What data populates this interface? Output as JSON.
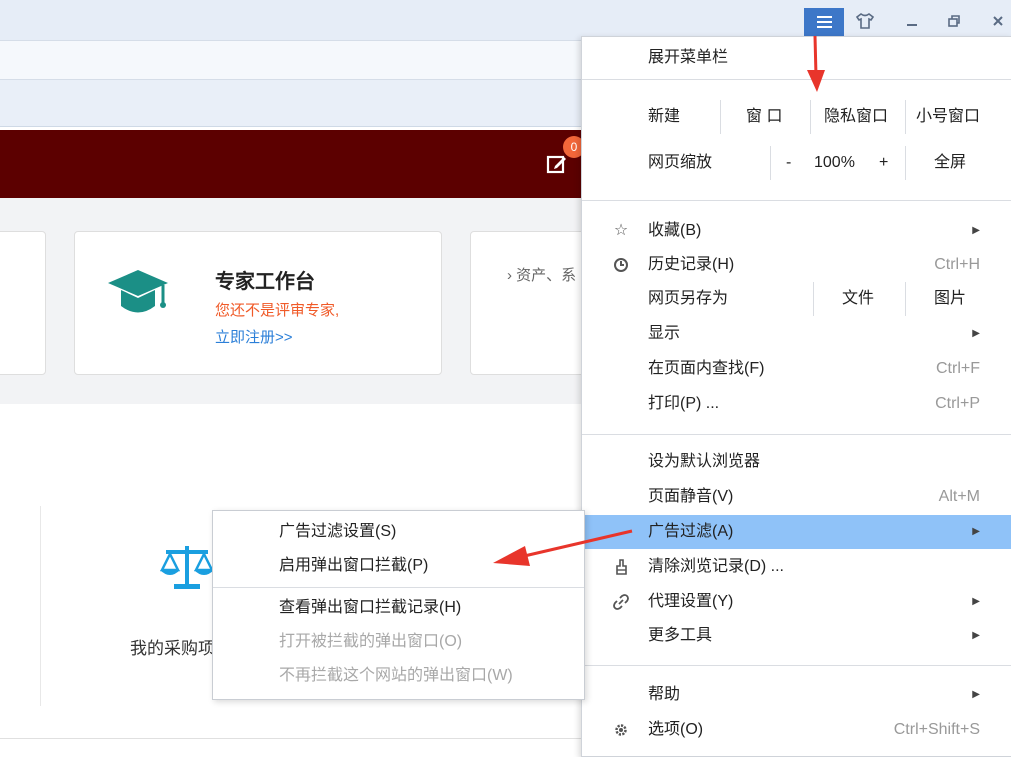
{
  "banner": {
    "badge_count": "0"
  },
  "card_expert": {
    "title": "专家工作台",
    "warn": "您还不是评审专家,",
    "link": "立即注册>>"
  },
  "card_assets": {
    "text": "› 资产、系"
  },
  "purchase": {
    "label": "我的采购项"
  },
  "main_menu": {
    "expand_menubar": "展开菜单栏",
    "new": {
      "label": "新建",
      "window": "窗 口",
      "private": "隐私窗口",
      "small": "小号窗口"
    },
    "zoom": {
      "label": "网页缩放",
      "minus": "-",
      "value": "100%",
      "plus": "+",
      "fullscreen": "全屏"
    },
    "favorites": "收藏(B)",
    "history": {
      "label": "历史记录(H)",
      "shortcut": "Ctrl+H"
    },
    "save_as": {
      "label": "网页另存为",
      "file": "文件",
      "image": "图片"
    },
    "display": "显示",
    "find": {
      "label": "在页面内查找(F)",
      "shortcut": "Ctrl+F"
    },
    "print": {
      "label": "打印(P) ...",
      "shortcut": "Ctrl+P"
    },
    "set_default": "设为默认浏览器",
    "mute": {
      "label": "页面静音(V)",
      "shortcut": "Alt+M"
    },
    "ad_filter": "广告过滤(A)",
    "clear_history": "清除浏览记录(D) ...",
    "proxy": "代理设置(Y)",
    "more_tools": "更多工具",
    "help": "帮助",
    "options": {
      "label": "选项(O)",
      "shortcut": "Ctrl+Shift+S"
    }
  },
  "submenu": {
    "ad_settings": "广告过滤设置(S)",
    "enable_popup_block": "启用弹出窗口拦截(P)",
    "view_block_log": "查看弹出窗口拦截记录(H)",
    "open_blocked": "打开被拦截的弹出窗口(O)",
    "never_block_site": "不再拦截这个网站的弹出窗口(W)"
  },
  "colors": {
    "highlight": "#8fc2f8",
    "banner": "#5c0000",
    "accent": "#3d77c8",
    "teal": "#1b8f86",
    "arrow": "#e8352b"
  },
  "icons": [
    "menu-icon",
    "skin-icon",
    "minimize-icon",
    "restore-icon",
    "close-icon",
    "edit-icon",
    "graduation-cap-icon",
    "scale-icon",
    "star-icon",
    "clock-icon",
    "broom-icon",
    "link-icon",
    "gear-icon"
  ]
}
